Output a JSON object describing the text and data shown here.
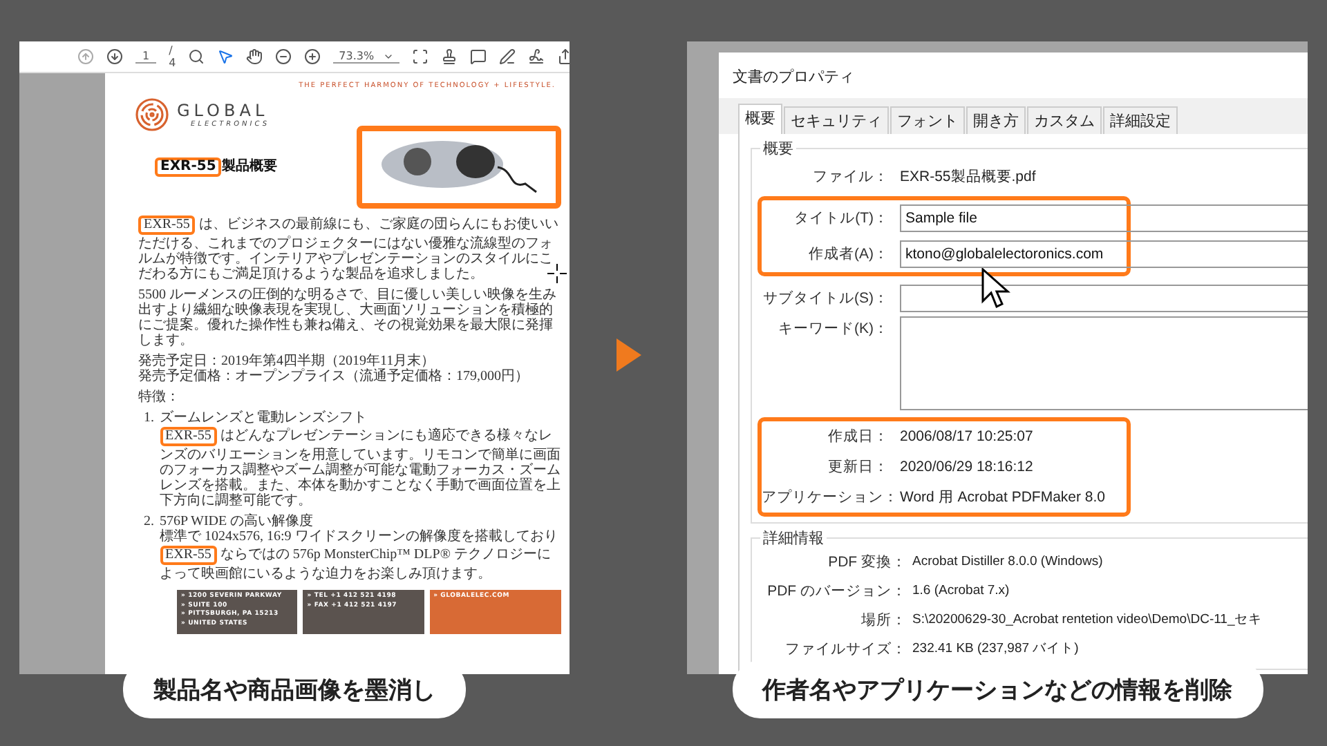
{
  "left_panel": {
    "toolbar": {
      "page": "1",
      "page_count": "/ 4",
      "zoom": "73.3%"
    },
    "document": {
      "tagline": "THE PERFECT HARMONY OF TECHNOLOGY + LIFESTYLE.",
      "logo": {
        "name": "GLOBAL",
        "subtitle": "ELECTRONICS"
      },
      "heading": [
        {
          "text": "EXR-55",
          "marked": true
        },
        {
          "text": "製品概要",
          "marked": false
        }
      ],
      "product_image": {
        "marked": true
      },
      "paragraphs": [
        [
          {
            "text": "EXR-55",
            "marked": true
          },
          {
            "text": " は、ビジネスの最前線にも、ご家庭の団らんにもお使いいただける、これまでのプロジェクターにはない優雅な流線型のフォルムが特徴です。インテリアやプレゼンテーションのスタイルにこだわる方にもご満足頂けるような製品を追求しました。",
            "marked": false
          }
        ],
        [
          {
            "text": "5500 ルーメンスの圧倒的な明るさで、目に優しい美しい映像を生み出すより繊細な映像表現を実現し、大画面ソリューションを積極的にご提案。優れた操作性も兼ね備え、その視覚効果を最大限に発揮します。",
            "marked": false
          }
        ]
      ],
      "release": [
        "発売予定日：2019年第4四半期（2019年11月末）",
        "発売予定価格：オープンプライス（流通予定価格：179,000円）"
      ],
      "features_label": "特徴：",
      "features": [
        {
          "number": "1.",
          "title": "ズームレンズと電動レンズシフト",
          "body": [
            {
              "text": "EXR-55",
              "marked": true
            },
            {
              "text": " はどんなプレゼンテーションにも適応できる様々なレンズのバリエーションを用意しています。リモコンで簡単に画面のフォーカス調整やズーム調整が可能な電動フォーカス・ズームレンズを搭載。また、本体を動かすことなく手動で画面位置を上下方向に調整可能です。",
              "marked": false
            }
          ]
        },
        {
          "number": "2.",
          "title": "576P WIDE の高い解像度",
          "body": [
            {
              "text": "標準で 1024x576, 16:9 ワイドスクリーンの解像度を搭載しており ",
              "marked": false
            },
            {
              "text": "EXR-55",
              "marked": true
            },
            {
              "text": " ならではの 576p MonsterChip™ DLP® テクノロジーによって映画館にいるような迫力をお楽しみ頂けます。",
              "marked": false
            }
          ]
        }
      ],
      "footer": [
        {
          "lines": [
            "» 1200 SEVERIN PARKWAY",
            "» SUITE 100",
            "» PITTSBURGH, PA 15213",
            "» UNITED STATES"
          ],
          "color": "#5b534f"
        },
        {
          "lines": [
            "» TEL +1 412 521 4198",
            "» FAX +1 412 521 4197"
          ],
          "color": "#5b534f"
        },
        {
          "lines": [
            "» GLOBALELEC.COM"
          ],
          "color": "#d86a35"
        }
      ]
    },
    "caption": "製品名や商品画像を墨消し"
  },
  "right_panel": {
    "dialog": {
      "title": "文書のプロパティ",
      "tabs": [
        {
          "label": "概要",
          "selected": true
        },
        {
          "label": "セキュリティ",
          "selected": false
        },
        {
          "label": "フォント",
          "selected": false
        },
        {
          "label": "開き方",
          "selected": false
        },
        {
          "label": "カスタム",
          "selected": false
        },
        {
          "label": "詳細設定",
          "selected": false
        }
      ],
      "summary": {
        "label": "概要",
        "rows": [
          {
            "kind": "text",
            "label": "ファイル：",
            "value": "EXR-55製品概要.pdf",
            "marked": false
          },
          {
            "kind": "field",
            "label": "タイトル(T)：",
            "value": "Sample file",
            "marked": true
          },
          {
            "kind": "field",
            "label": "作成者(A)：",
            "value": "ktono@globalelectoronics.com",
            "marked": true
          },
          {
            "kind": "field",
            "label": "サブタイトル(S)：",
            "marked": false
          },
          {
            "kind": "area",
            "label": "キーワード(K)：",
            "marked": false
          },
          {
            "kind": "text",
            "label": "作成日：",
            "value": "2006/08/17 10:25:07",
            "marked": true
          },
          {
            "kind": "text",
            "label": "更新日：",
            "value": "2020/06/29 18:16:12",
            "marked": true
          },
          {
            "kind": "text",
            "label": "アプリケーション：",
            "value": "Word 用 Acrobat PDFMaker 8.0",
            "marked": true
          }
        ]
      },
      "details": {
        "label": "詳細情報",
        "rows": [
          {
            "label": "PDF 変換：",
            "value": "Acrobat Distiller 8.0.0 (Windows)"
          },
          {
            "label": "PDF のバージョン：",
            "value": "1.6 (Acrobat 7.x)"
          },
          {
            "label": "場所：",
            "value": "S:\\20200629-30_Acrobat rentetion video\\Demo\\DC-11_セキ"
          },
          {
            "label": "ファイルサイズ：",
            "value": "232.41 KB (237,987 バイト)"
          }
        ]
      }
    },
    "caption": "作者名やアプリケーションなどの情報を削除"
  }
}
